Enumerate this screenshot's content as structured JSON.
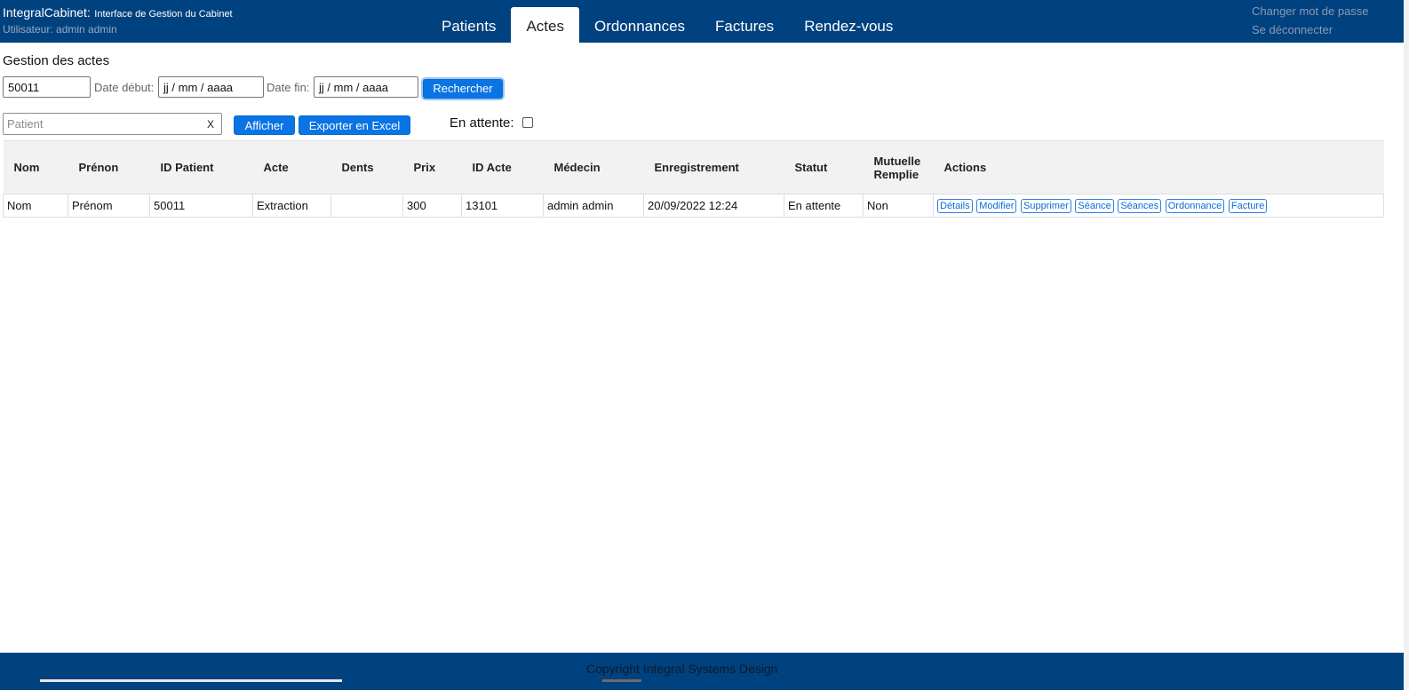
{
  "header": {
    "app_name": "IntegralCabinet:",
    "app_subtitle": "Interface de Gestion du Cabinet",
    "user": "Utilisateur: admin admin",
    "tabs": [
      {
        "label": "Patients"
      },
      {
        "label": "Actes"
      },
      {
        "label": "Ordonnances"
      },
      {
        "label": "Factures"
      },
      {
        "label": "Rendez-vous"
      }
    ],
    "change_password": "Changer mot de passe",
    "logout": "Se déconnecter"
  },
  "main": {
    "title": "Gestion des actes",
    "search": {
      "id_value": "50011",
      "date_start_label": "Date début:",
      "date_start_value": "jj / mm / aaaa",
      "date_end_label": "Date fin:",
      "date_end_value": "jj / mm / aaaa",
      "search_button": "Rechercher"
    },
    "filter": {
      "patient_placeholder": "Patient",
      "clear_label": "X",
      "show_button": "Afficher",
      "export_button": "Exporter en Excel",
      "pending_label": "En attente:"
    },
    "table": {
      "headers": [
        "Nom",
        "Prénon",
        "ID Patient",
        "Acte",
        "Dents",
        "Prix",
        "ID Acte",
        "Médecin",
        "Enregistrement",
        "Statut",
        "Mutuelle Remplie",
        "Actions"
      ],
      "rows": [
        {
          "nom": "Nom",
          "prenom": "Prénom",
          "id_patient": "50011",
          "acte": "Extraction",
          "dents": "",
          "prix": "300",
          "id_acte": "13101",
          "medecin": "admin admin",
          "enregistrement": "20/09/2022 12:24",
          "statut": "En attente",
          "mutuelle": "Non",
          "actions": [
            "Détails",
            "Modifier",
            "Supprimer",
            "Séance",
            "Séances",
            "Ordonnance",
            "Facture"
          ]
        }
      ]
    }
  },
  "footer": {
    "copyright": "Copyright Integral Systems Design"
  }
}
